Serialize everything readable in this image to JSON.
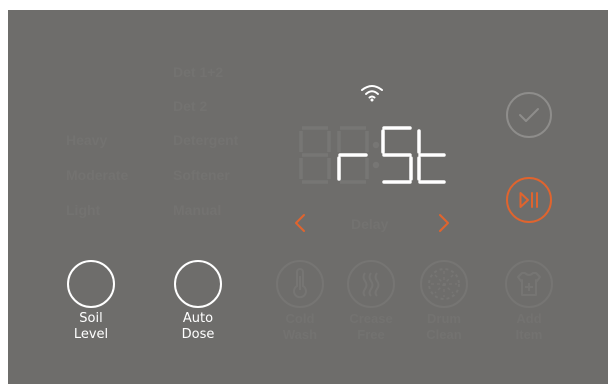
{
  "soil_levels": [
    "Heavy",
    "Moderate",
    "Light"
  ],
  "detergent_options": [
    "Det 1+2",
    "Det 2",
    "Detergent",
    "Softener",
    "Manual"
  ],
  "display": {
    "ghost_left": "88",
    "separator": ":",
    "code": "r-5t",
    "segment_color": "#ffffff",
    "ghost_color": "#777674"
  },
  "delay_label": "Delay",
  "buttons": {
    "soil_level": {
      "line1": "Soil",
      "line2": "Level"
    },
    "auto_dose": {
      "line1": "Auto",
      "line2": "Dose"
    }
  },
  "options": [
    {
      "line1": "Cold",
      "line2": "Wash",
      "icon": "thermometer-icon"
    },
    {
      "line1": "Crease",
      "line2": "Free",
      "icon": "crease-free-icon"
    },
    {
      "line1": "Drum",
      "line2": "Clean",
      "icon": "drum-clean-icon"
    },
    {
      "line1": "Add",
      "line2": "Item",
      "icon": "add-item-icon"
    }
  ],
  "colors": {
    "panel": "#6e6d6b",
    "accent": "#e0642e",
    "inactive": "#737270",
    "active_text": "#ffffff"
  }
}
